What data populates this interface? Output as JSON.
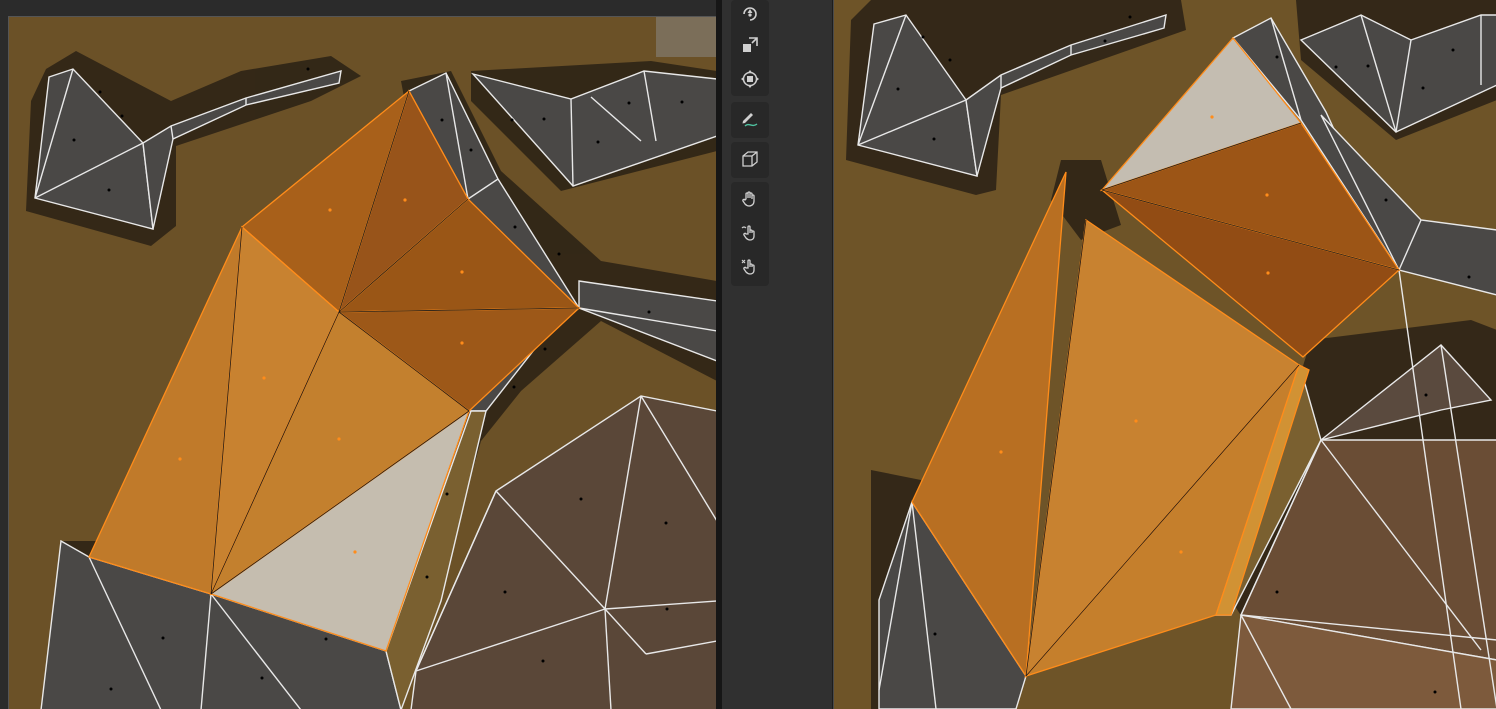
{
  "colors": {
    "ground": "#6b5127",
    "mesh_gray": "#4a4846",
    "mesh_selected": "#b8701e",
    "mesh_selected_dark": "#8a4a12",
    "mesh_active": "#c9c2b6",
    "edge_white": "#e8e8e8",
    "edge_orange": "#ff8c1a",
    "ui_panel": "#303030",
    "ui_group": "#282828",
    "icon": "#d0d0d0"
  },
  "toolbar": {
    "tools": [
      {
        "name": "rotate-icon"
      },
      {
        "name": "scale-icon"
      },
      {
        "name": "transform-icon"
      },
      {
        "name": "annotate-icon"
      },
      {
        "name": "add-cube-icon"
      },
      {
        "name": "grab-hand-icon"
      },
      {
        "name": "uv-grab-icon"
      },
      {
        "name": "uv-pinch-icon"
      }
    ]
  }
}
